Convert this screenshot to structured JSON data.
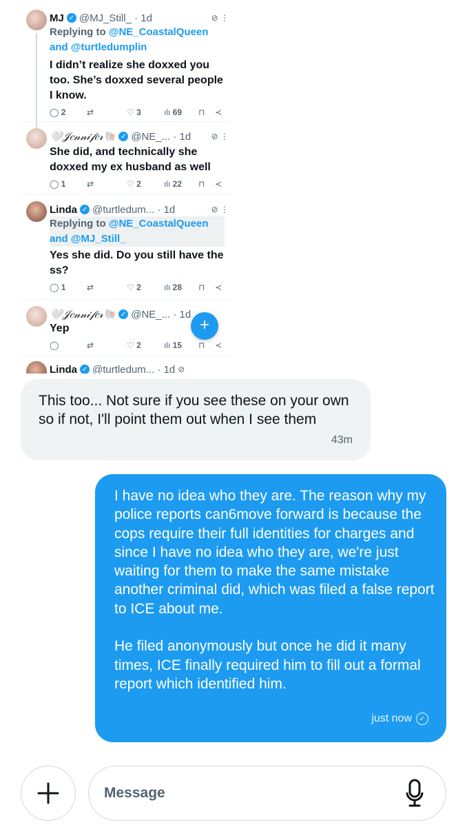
{
  "thread": {
    "tweets": [
      {
        "name": "MJ",
        "handle": "@MJ_Still_ · 1d",
        "reply_prefix": "Replying to ",
        "reply_mention_1": "@NE_CoastalQueen",
        "reply_joiner": "and ",
        "reply_mention_2": "@turtledumplin",
        "body": "I didn’t realize she doxxed you too. She’s doxxed several people I know.",
        "replies": "2",
        "likes": "3",
        "views": "69"
      },
      {
        "name": "🤍𝒥𝑒𝓃𝓃𝒾𝒻𝑒𝓇🐚",
        "handle": "@NE_... · 1d",
        "body": "She did, and technically she doxxed my ex husband as well",
        "replies": "1",
        "likes": "2",
        "views": "22"
      },
      {
        "name": "Linda",
        "handle": "@turtledum... · 1d",
        "reply_prefix": "Replying to ",
        "reply_mention_1": "@NE_CoastalQueen",
        "reply_joiner": "and ",
        "reply_mention_2": "@MJ_Still_",
        "body": "Yes she did. Do you still have the ss?",
        "replies": "1",
        "likes": "2",
        "views": "28"
      },
      {
        "name": "🤍𝒥𝑒𝓃𝓃𝒾𝒻𝑒𝓇🐚",
        "handle": "@NE_... · 1d",
        "body": "Yep",
        "replies": "",
        "likes": "2",
        "views": "15"
      },
      {
        "name": "Linda",
        "handle": "@turtledum... · 1d"
      }
    ]
  },
  "messages": {
    "incoming": {
      "text": "This too... Not sure if you see these on your own so if not, I'll point them out when I see them",
      "time": "43m"
    },
    "outgoing": {
      "text": "I have no idea who they are.  The reason why my police reports can6move forward is because the cops require their full identities for charges and since I have no idea who they are, we're just waiting for them to make the same mistake another criminal did, which was filed a false report to ICE about me.\n\nHe filed anonymously but once he did it many times, ICE finally required him to fill out a formal report which identified him.",
      "time": "just now"
    }
  },
  "composer": {
    "placeholder": "Message"
  },
  "colors": {
    "accent": "#1d9bf0",
    "incoming_bg": "#eff3f4",
    "muted": "#536471"
  }
}
